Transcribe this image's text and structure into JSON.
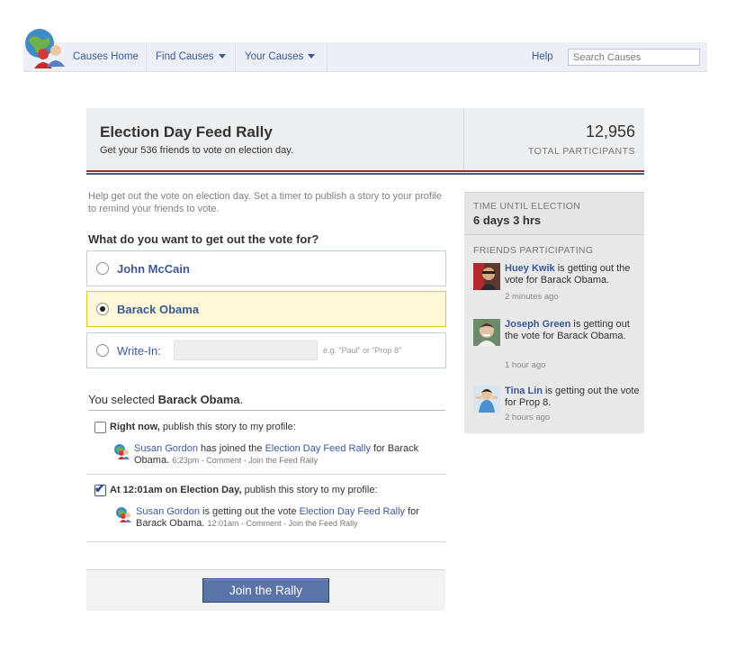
{
  "nav": {
    "items": [
      "Causes Home",
      "Find Causes",
      "Your Causes"
    ],
    "help": "Help",
    "search_placeholder": "Search Causes"
  },
  "header": {
    "title": "Election Day Feed Rally",
    "subtitle": "Get your 536 friends to vote on election day.",
    "count": "12,956",
    "count_label": "TOTAL PARTICIPANTS"
  },
  "main": {
    "intro": "Help get out the vote on election day. Set a timer to publish a story to your profile to remind your friends to vote.",
    "question": "What do you want to get out the vote for?",
    "options": [
      {
        "label": "John McCain",
        "selected": false
      },
      {
        "label": "Barack Obama",
        "selected": true
      },
      {
        "label": "Write-In:",
        "selected": false,
        "hint": "e.g. “Paul” or “Prop 8”"
      }
    ],
    "selected_prefix": "You selected ",
    "selected_name": "Barack Obama",
    "selected_suffix": ".",
    "publish": [
      {
        "checked": false,
        "label_bold": "Right now,",
        "label_rest": " publish this story to my profile:",
        "story": {
          "name": "Susan Gordon",
          "verb": " has joined the ",
          "link": "Election Day Feed Rally",
          "rest": " for Barack Obama.",
          "time": "6:23pm",
          "sep1": " - ",
          "comment": "Comment",
          "sep2": " - ",
          "join": "Join the Feed Rally"
        }
      },
      {
        "checked": true,
        "label_bold": "At 12:01am on Election Day,",
        "label_rest": " publish this story to my profile:",
        "story": {
          "name": "Susan Gordon",
          "verb": " is getting out the vote ",
          "link": "Election Day Feed Rally",
          "rest": " for Barack Obama.",
          "time": "12:01am",
          "sep1": " - ",
          "comment": "Comment",
          "sep2": " - ",
          "join": "Join the Feed Rally"
        }
      }
    ],
    "join_button": "Join the Rally"
  },
  "sidebar": {
    "timer_label": "TIME UNTIL ELECTION",
    "timer_value": "6 days 3 hrs",
    "friends_label": "FRIENDS PARTICIPATING",
    "friends": [
      {
        "name": "Huey Kwik",
        "text": " is getting out the vote for Barack Obama.",
        "time": "2 minutes ago"
      },
      {
        "name": "Joseph Green",
        "text": " is getting out the vote for Barack Obama.",
        "time": "1 hour ago"
      },
      {
        "name": "Tina Lin",
        "text": " is getting out the vote for Prop 8.",
        "time": "2 hours ago"
      }
    ]
  },
  "colors": {
    "link": "#3b5998",
    "selected_bg": "#fff9d7",
    "selected_border": "#e2c822",
    "stripe_red": "#9a2d2d",
    "stripe_blue": "#3d5a9a"
  },
  "icons": [
    "causes-logo-icon",
    "chevron-down-icon",
    "story-icon"
  ]
}
